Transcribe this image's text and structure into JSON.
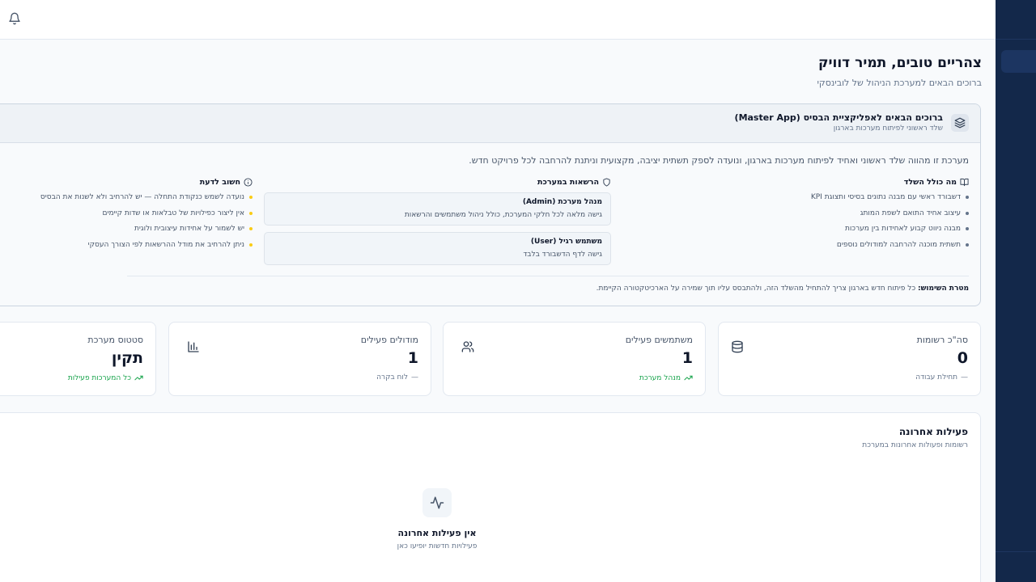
{
  "header": {
    "notifications_icon": "bell-icon"
  },
  "sidebar": {
    "background": "#13284a"
  },
  "welcome": {
    "title": "צהריים טובים, תמיר דוויק",
    "subtitle": "ברוכים הבאים למערכת הניהול של לובינסקי"
  },
  "master_app": {
    "icon": "layers-icon",
    "title": "ברוכים הבאים לאפליקציית הבסיס (Master App)",
    "subtitle": "שלד ראשוני לפיתוח מערכות בארגון",
    "description": "מערכת זו מהווה שלד ראשוני ואחיד לפיתוח מערכות בארגון, ונועדה לספק תשתית יציבה, מקצועית וניתנת להרחבה לכל פרויקט חדש.",
    "includes": {
      "heading": "מה כולל השלד",
      "icon": "book-open-icon",
      "items": [
        "דשבורד ראשי עם מבנה נתונים בסיסי ותצוגת KPI",
        "עיצוב אחיד התואם לשפת המותג",
        "מבנה ניווט קבוע לאחידות בין מערכות",
        "תשתית מוכנה להרחבה למודולים נוספים"
      ]
    },
    "permissions": {
      "heading": "הרשאות במערכת",
      "icon": "shield-icon",
      "roles": [
        {
          "title": "מנהל מערכת (Admin)",
          "desc": "גישה מלאה לכל חלקי המערכת, כולל ניהול משתמשים והרשאות"
        },
        {
          "title": "משתמש רגיל (User)",
          "desc": "גישה לדף הדשבורד בלבד"
        }
      ]
    },
    "notes": {
      "heading": "חשוב לדעת",
      "icon": "info-icon",
      "items": [
        "נועדה לשמש כנקודת התחלה — יש להרחיב ולא לשנות את הבסיס",
        "אין ליצור כפילויות של טבלאות או שדות קיימים",
        "יש לשמור על אחידות עיצובית ולוגית",
        "ניתן להרחיב את מודל ההרשאות לפי הצורך העסקי"
      ]
    },
    "goal_label": "מטרת השימוש:",
    "goal_text": "כל פיתוח חדש בארגון צריך להתחיל מהשלד הזה, ולהתבסס עליו תוך שמירה על הארכיטקטורה הקיימת."
  },
  "stats": [
    {
      "label": "סה\"כ רשומות",
      "value": "0",
      "foot": "תחילת עבודה",
      "foot_type": "neutral",
      "icon": "database-icon"
    },
    {
      "label": "משתמשים פעילים",
      "value": "1",
      "foot": "מנהל מערכת",
      "foot_type": "green",
      "icon": "users-icon"
    },
    {
      "label": "מודולים פעילים",
      "value": "1",
      "foot": "לוח בקרה",
      "foot_type": "neutral",
      "icon": "bar-chart-icon"
    },
    {
      "label": "סטטוס מערכת",
      "value": "תקין",
      "foot": "כל המערכות פעילות",
      "foot_type": "green",
      "icon": "activity-icon"
    }
  ],
  "activity": {
    "title": "פעילות אחרונה",
    "subtitle": "רשומות ופעולות אחרונות במערכת",
    "empty_icon": "activity-icon",
    "empty_title": "אין פעילות אחרונה",
    "empty_subtitle": "פעילויות חדשות יופיעו כאן"
  },
  "colors": {
    "accent_green": "#16a34a",
    "bullet_gray": "#64748b",
    "bullet_yellow": "#facc15"
  }
}
